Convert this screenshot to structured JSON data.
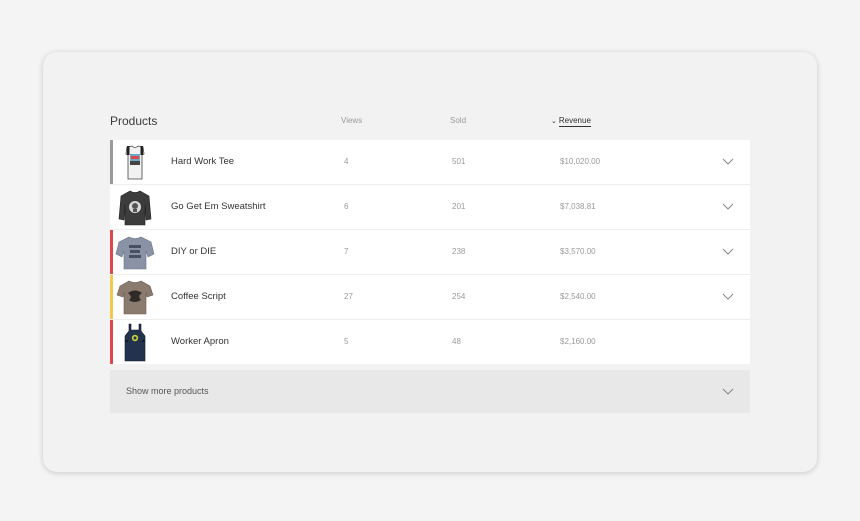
{
  "header": {
    "title": "Products",
    "columns": {
      "views": "Views",
      "sold": "Sold",
      "revenue": "Revenue"
    },
    "sort_icon": "chevron-down-icon"
  },
  "products": [
    {
      "name": "Hard Work Tee",
      "views": "4",
      "sold": "501",
      "revenue": "$10,020.00",
      "indicator_color": "#9b9b9b",
      "has_expand": true
    },
    {
      "name": "Go Get Em Sweatshirt",
      "views": "6",
      "sold": "201",
      "revenue": "$7,038.81",
      "indicator_color": "#ffffff",
      "has_expand": true
    },
    {
      "name": "DIY or DIE",
      "views": "7",
      "sold": "238",
      "revenue": "$3,570.00",
      "indicator_color": "#e0474c",
      "has_expand": true
    },
    {
      "name": "Coffee Script",
      "views": "27",
      "sold": "254",
      "revenue": "$2,540.00",
      "indicator_color": "#f2c94c",
      "has_expand": true
    },
    {
      "name": "Worker Apron",
      "views": "5",
      "sold": "48",
      "revenue": "$2,160.00",
      "indicator_color": "#e0474c",
      "has_expand": false
    }
  ],
  "show_more": {
    "label": "Show more products"
  },
  "colors": {
    "background": "#f4f4f4",
    "card": "#f2f2f2",
    "table": "#ffffff",
    "show_more": "#e8e8e8"
  }
}
